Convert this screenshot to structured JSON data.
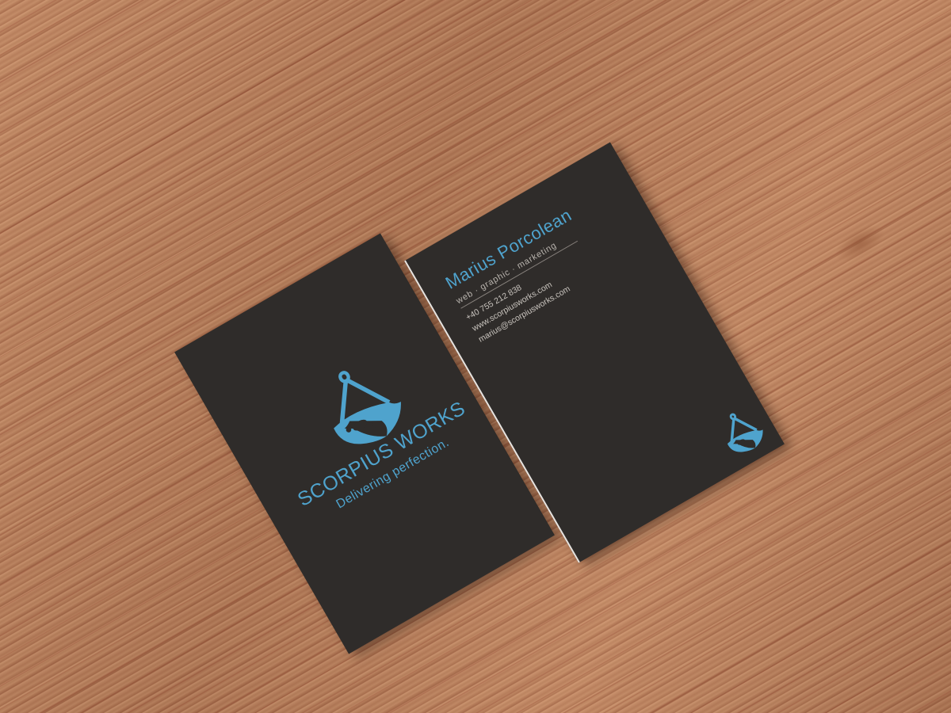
{
  "scene": {
    "accent_color": "#4fa3cd",
    "card_color": "#2f2c2a",
    "background": "wood"
  },
  "back_card": {
    "logo": "scorpion-anchor-logo",
    "brand": "SCORPIUS WORKS",
    "tagline": "Delivering perfection."
  },
  "front_card": {
    "name": "Marius Porcolean",
    "role": "web · graphic · marketing",
    "phone": "+40 755 212 838",
    "website": "www.scorpiusworks.com",
    "email": "marius@scorpiusworks.com",
    "logo": "scorpion-anchor-logo"
  }
}
